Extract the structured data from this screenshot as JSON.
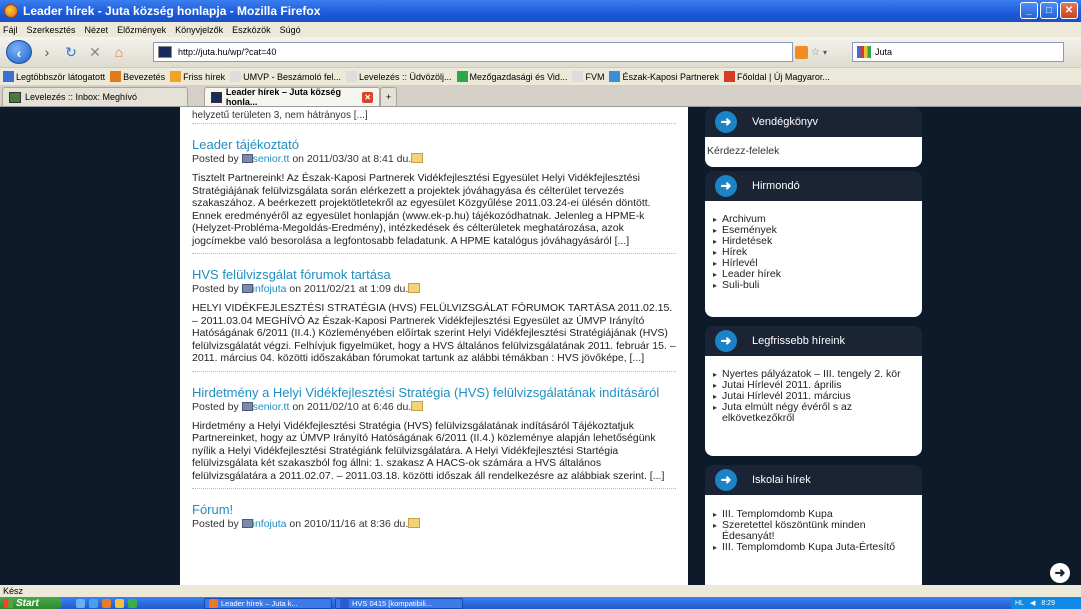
{
  "window": {
    "title": "Leader hírek - Juta község honlapja - Mozilla Firefox"
  },
  "menu": [
    "Fájl",
    "Szerkesztés",
    "Nézet",
    "Előzmények",
    "Könyvjelzők",
    "Eszközök",
    "Súgó"
  ],
  "nav": {
    "url": "http://juta.hu/wp/?cat=40",
    "search_value": "Juta"
  },
  "bookmarks": [
    {
      "label": "Legtöbbször látogatott",
      "color": "#3a6fd8"
    },
    {
      "label": "Bevezetés",
      "color": "#e07a1a"
    },
    {
      "label": "Friss hírek",
      "color": "#f2a12a"
    },
    {
      "label": "UMVP - Beszámoló fel...",
      "color": "#dddddd"
    },
    {
      "label": "Levelezés :: Üdvözölj...",
      "color": "#dddddd"
    },
    {
      "label": "Mezőgazdasági és Vid...",
      "color": "#2aa84a"
    },
    {
      "label": "FVM",
      "color": "#dddddd"
    },
    {
      "label": "Észak-Kaposi Partnerek",
      "color": "#3a8fd8"
    },
    {
      "label": "Főoldal | Új Magyaror...",
      "color": "#d83a2a"
    }
  ],
  "tabs": [
    {
      "label": "Levelezés :: Inbox: Meghívó",
      "active": false
    },
    {
      "label": "Leader hírek – Juta község honla...",
      "active": true
    }
  ],
  "main": {
    "cut_text": "helyzetű területen 3, nem hátrányos [...]",
    "posts": [
      {
        "title": "Leader tájékoztató",
        "posted_by": "Posted by",
        "author": "senior.tt",
        "date": "on 2011/03/30 at 8:41 du.",
        "body": "Tisztelt Partnereink! Az Észak-Kaposi Partnerek Vidékfejlesztési Egyesület Helyi Vidékfejlesztési Stratégiájának felülvizsgálata során elérkezett a projektek jóváhagyása és célterület tervezés szakaszához. A beérkezett projektötletekről az egyesület Közgyűlése 2011.03.24-ei ülésén döntött. Ennek eredményéről az egyesület honlapján (www.ek-p.hu) tájékozódhatnak. Jelenleg a HPME-k (Helyzet-Probléma-Megoldás-Eredmény), intézkedések és célterületek meghatározása, azok jogcímekbe való besorolása a legfontosabb feladatunk. A HPME katalógus jóváhagyásáról [...]"
      },
      {
        "title": "HVS felülvizsgálat fórumok tartása",
        "posted_by": "Posted by",
        "author": "infojuta",
        "date": "on 2011/02/21 at 1:09 du.",
        "body": "HELYI VIDÉKFEJLESZTÉSI STRATÉGIA (HVS) FELÜLVIZSGÁLAT FÓRUMOK TARTÁSA 2011.02.15. – 2011.03.04 MEGHÍVÓ Az Észak-Kaposi Partnerek Vidékfejlesztési Egyesület az ÚMVP Irányító Hatóságának 6/2011 (II.4.) Közleményében előírtak szerint Helyi Vidékfejlesztési Stratégiájának (HVS) felülvizsgálatát végzi. Felhívjuk figyelmüket, hogy a HVS általános felülvizsgálatának 2011. február 15. – 2011. március 04. közötti időszakában fórumokat tartunk az alábbi témákban : HVS jövőképe, [...]"
      },
      {
        "title": "Hirdetmény a Helyi Vidékfejlesztési Stratégia (HVS) felülvizsgálatának indításáról",
        "posted_by": "Posted by",
        "author": "senior.tt",
        "date": "on 2011/02/10 at 6:46 du.",
        "body": "Hirdetmény a Helyi Vidékfejlesztési Stratégia (HVS) felülvizsgálatának indításáról Tájékoztatjuk Partnereinket, hogy az ÚMVP Irányító Hatóságának 6/2011 (II.4.) közleménye alapján lehetőségünk nyílik a Helyi Vidékfejlesztési Stratégiánk felülvizsgálatára. A Helyi Vidékfejlesztési Startégia felülvizsgálata két szakaszból fog állni: 1. szakasz A HACS-ok számára a HVS általános felülvizsgálatára a 2011.02.07. – 2011.03.18. közötti időszak áll rendelkezésre az alábbiak szerint. [...]"
      },
      {
        "title": "Fórum!",
        "posted_by": "Posted by",
        "author": "infojuta",
        "date": "on 2010/11/16 at 8:36 du.",
        "body": ""
      }
    ]
  },
  "sidebar": {
    "guestbook": {
      "title": "Vendégkönyv",
      "text": "Kérdezz-felelek"
    },
    "hirmondo": {
      "title": "Hirmondó",
      "items": [
        "Archivum",
        "Események",
        "Hirdetések",
        "Hírek",
        "Hírlevél",
        "Leader hírek",
        "Suli-buli"
      ]
    },
    "latest": {
      "title": "Legfrissebb híreink",
      "items": [
        "Nyertes pályázatok – III. tengely 2. kör",
        "Jutai Hírlevél 2011. április",
        "Jutai Hírlevél 2011. március",
        "Juta elmúlt négy évéről s az elkövetkezőkről"
      ]
    },
    "school": {
      "title": "Iskolai hírek",
      "items": [
        "III. Templomdomb Kupa",
        "Szeretettel köszöntünk minden Édesanyát!",
        "III. Templomdomb Kupa Juta-Értesítő"
      ]
    }
  },
  "status": "Kész",
  "taskbar": {
    "start": "Start",
    "items": [
      "Leader hírek – Juta k...",
      "HVS 0415 [kompatibili..."
    ],
    "tray_lang": "HL",
    "clock": "8:29"
  }
}
